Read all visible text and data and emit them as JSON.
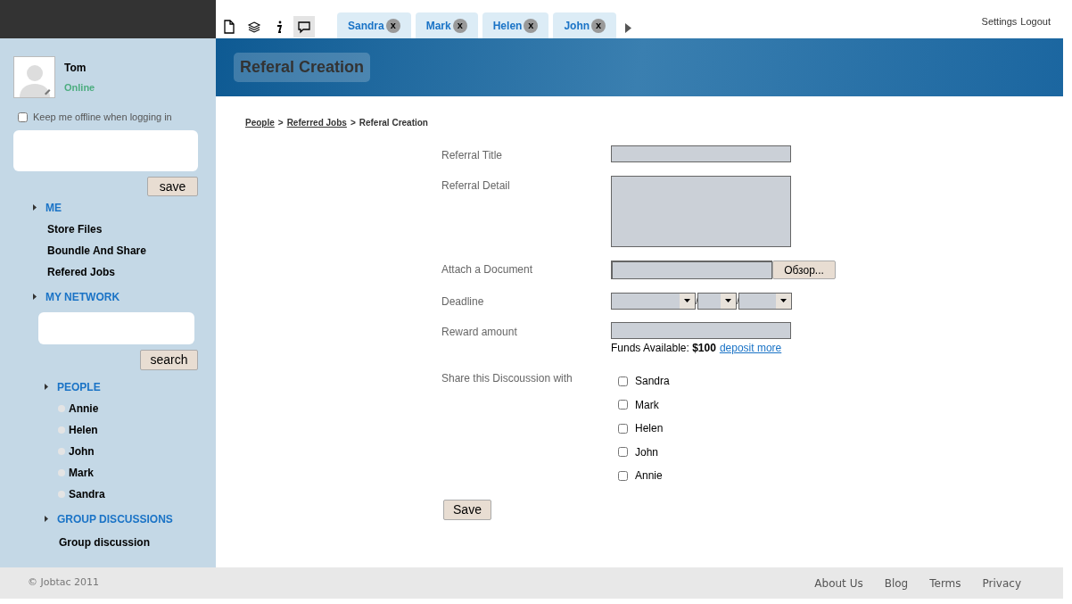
{
  "toolbar": [
    {
      "kind": "page",
      "selected": false
    },
    {
      "kind": "layers",
      "selected": false
    },
    {
      "kind": "info",
      "selected": false
    },
    {
      "kind": "chat",
      "selected": true
    }
  ],
  "tabs": [
    {
      "label": "Sandra",
      "close": "x"
    },
    {
      "label": "Mark",
      "close": "x"
    },
    {
      "label": "Helen",
      "close": "x"
    },
    {
      "label": "John",
      "close": "x"
    }
  ],
  "top_links": [
    "Settings",
    "Logout"
  ],
  "user": {
    "name": "Tom",
    "status": "Online",
    "keep_offline": {
      "label": "Keep me offline when logging in",
      "checked": false
    },
    "save_button": "save"
  },
  "sidebar": {
    "me": {
      "title": "ME",
      "items": [
        "Store Files",
        "Boundle And Share",
        "Refered Jobs"
      ]
    },
    "network": {
      "title": "MY NETWORK",
      "search_button": "search",
      "people": {
        "title": "PEOPLE",
        "items": [
          "Annie",
          "Helen",
          "John",
          "Mark",
          "Sandra"
        ]
      },
      "groups": {
        "title": "GROUP DISCUSSIONS",
        "items": [
          "Group discussion"
        ]
      }
    }
  },
  "page_title": "Referal Creation",
  "breadcrumb": [
    {
      "label": "People",
      "link": true
    },
    {
      "label": "Referred Jobs",
      "link": true
    },
    {
      "label": "Referal Creation",
      "link": false
    }
  ],
  "separator": ">",
  "form": {
    "title_label": "Referral Title",
    "detail_label": "Referral Detail",
    "attach_label": "Attach a Document",
    "browse_button": "Обзор...",
    "deadline_label": "Deadline",
    "date_sep": "/",
    "reward_label": "Reward amount",
    "funds": "Funds Available: **$100**",
    "deposit_link": "deposit more",
    "share_label": "Share this Discoussion with",
    "share": [
      {
        "name": "Sandra",
        "checked": false
      },
      {
        "name": "Mark",
        "checked": false
      },
      {
        "name": "Helen",
        "checked": false
      },
      {
        "name": "John",
        "checked": false
      },
      {
        "name": "Annie",
        "checked": false
      }
    ],
    "save_button": "Save"
  },
  "footer": {
    "copyright": "© Jobtac 2011",
    "links": [
      "About Us",
      "Blog",
      "Terms",
      "Privacy"
    ]
  }
}
